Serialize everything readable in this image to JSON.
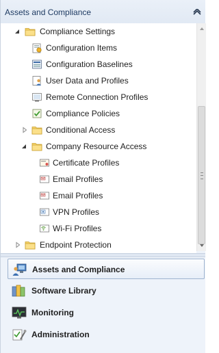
{
  "pane": {
    "title": "Assets and Compliance"
  },
  "tree": [
    {
      "label": "Compliance Settings",
      "icon": "folder-icon",
      "expanded": true,
      "level": 1
    },
    {
      "label": "Configuration Items",
      "icon": "configuration-item-icon",
      "level": 2
    },
    {
      "label": "Configuration Baselines",
      "icon": "configuration-baseline-icon",
      "level": 2
    },
    {
      "label": "User Data and Profiles",
      "icon": "user-data-icon",
      "level": 2
    },
    {
      "label": "Remote Connection Profiles",
      "icon": "remote-connection-icon",
      "level": 2
    },
    {
      "label": "Compliance Policies",
      "icon": "compliance-policy-icon",
      "level": 2
    },
    {
      "label": "Conditional Access",
      "icon": "folder-icon",
      "expanded": false,
      "level": 2
    },
    {
      "label": "Company Resource Access",
      "icon": "folder-icon",
      "expanded": true,
      "level": 2
    },
    {
      "label": "Certificate Profiles",
      "icon": "certificate-profile-icon",
      "level": 3
    },
    {
      "label": "Email Profiles",
      "icon": "email-profile-icon",
      "level": 3
    },
    {
      "label": "Email Profiles",
      "icon": "email-profile-icon",
      "level": 3
    },
    {
      "label": "VPN Profiles",
      "icon": "vpn-profile-icon",
      "level": 3
    },
    {
      "label": "Wi-Fi Profiles",
      "icon": "wifi-profile-icon",
      "level": 3
    },
    {
      "label": "Endpoint Protection",
      "icon": "folder-icon",
      "expanded": false,
      "level": 1
    }
  ],
  "wunderbar": [
    {
      "label": "Assets and Compliance",
      "icon": "assets-compliance-icon",
      "selected": true
    },
    {
      "label": "Software Library",
      "icon": "software-library-icon"
    },
    {
      "label": "Monitoring",
      "icon": "monitoring-icon"
    },
    {
      "label": "Administration",
      "icon": "administration-icon"
    }
  ],
  "colors": {
    "accent": "#1f3b63",
    "folder": "#f2c94c",
    "selection_border": "#9fb3cf"
  }
}
